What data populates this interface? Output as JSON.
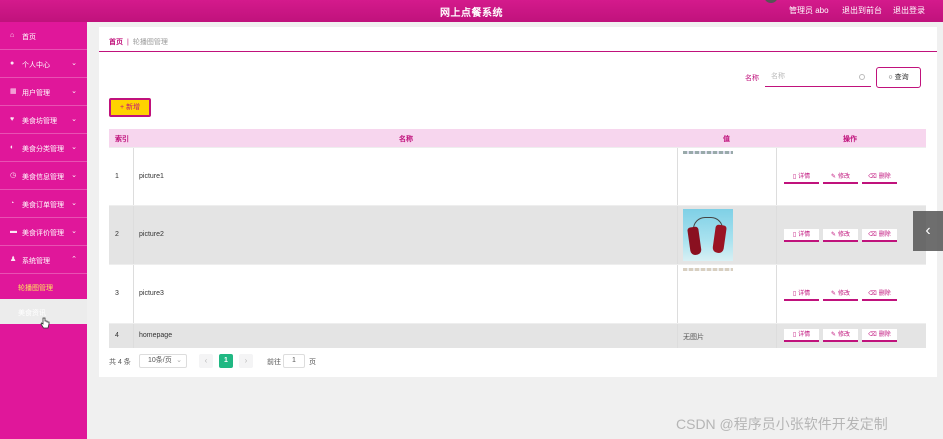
{
  "header": {
    "title": "网上点餐系统",
    "user_label": "管理员 abo",
    "to_front_label": "退出到前台",
    "logout_label": "退出登录"
  },
  "sidebar": {
    "items": [
      {
        "label": "首页",
        "icon": "home-icon",
        "expandable": false
      },
      {
        "label": "个人中心",
        "icon": "user-icon",
        "expandable": true
      },
      {
        "label": "用户管理",
        "icon": "grid-icon",
        "expandable": true
      },
      {
        "label": "美食坊管理",
        "icon": "heart-icon",
        "expandable": true
      },
      {
        "label": "美食分类管理",
        "icon": "bulb-icon",
        "expandable": true
      },
      {
        "label": "美食信息管理",
        "icon": "clock-icon",
        "expandable": true
      },
      {
        "label": "美食订单管理",
        "icon": "time-icon",
        "expandable": true
      },
      {
        "label": "美食评价管理",
        "icon": "card-icon",
        "expandable": true
      },
      {
        "label": "系统管理",
        "icon": "person-icon",
        "expandable": true,
        "expanded": true
      }
    ],
    "sub_items": [
      {
        "label": "轮播图管理"
      },
      {
        "label": "美食资讯"
      }
    ]
  },
  "breadcrumb": {
    "home": "首页",
    "current": "轮播图管理"
  },
  "search": {
    "label": "名称",
    "placeholder": "名称",
    "button_label": "查询"
  },
  "toolbar": {
    "add_label": "新增"
  },
  "table": {
    "headers": {
      "index": "索引",
      "name": "名称",
      "value": "值",
      "actions": "操作"
    },
    "rows": [
      {
        "index": "1",
        "name": "picture1",
        "value_text": ""
      },
      {
        "index": "2",
        "name": "picture2",
        "value_text": ""
      },
      {
        "index": "3",
        "name": "picture3",
        "value_text": ""
      },
      {
        "index": "4",
        "name": "homepage",
        "value_text": "无图片"
      }
    ],
    "actions": {
      "detail": "详情",
      "edit": "修改",
      "delete": "删除"
    }
  },
  "pager": {
    "total": "共 4 条",
    "page_size": "10条/页",
    "current_page": "1",
    "goto_label": "前往",
    "goto_value": "1",
    "page_unit": "页"
  },
  "watermark": "CSDN @程序员小张软件开发定制",
  "colors": {
    "brand": "#e0179a",
    "accent": "#c0127c",
    "add_button": "#ffd200",
    "pager_active": "#20b883",
    "table_header": "#f7d6ee"
  }
}
